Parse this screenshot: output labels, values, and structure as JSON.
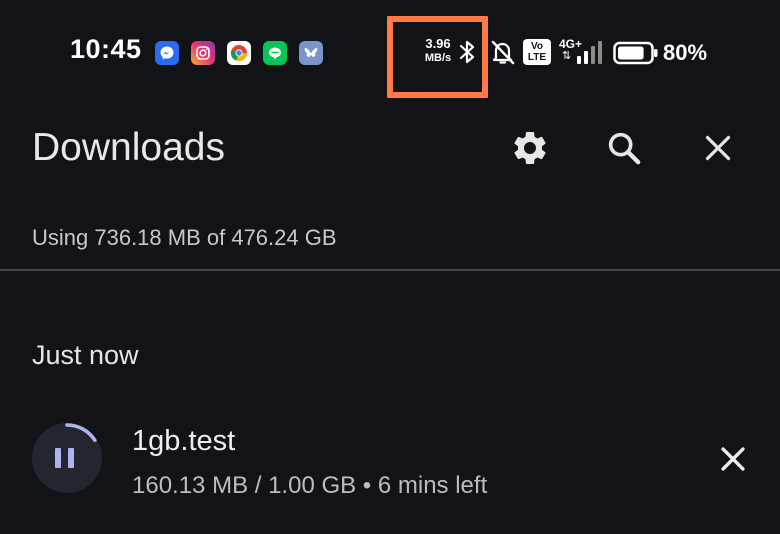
{
  "status_bar": {
    "time": "10:45",
    "app_icons": [
      "messenger-icon",
      "instagram-icon",
      "chrome-icon",
      "line-icon",
      "bluesky-icon"
    ],
    "net_speed_value": "3.96",
    "net_speed_unit": "MB/s",
    "volte_top": "Vo",
    "volte_bottom": "LTE",
    "network_type": "4G+",
    "network_arrows": "⇅",
    "battery_percent": "80%",
    "battery_level": 0.8,
    "highlight_color": "#ff7a45"
  },
  "header": {
    "title": "Downloads",
    "icons": [
      "gear-icon",
      "search-icon",
      "close-icon"
    ]
  },
  "storage": {
    "text": "Using 736.18 MB of 476.24 GB"
  },
  "section": {
    "label": "Just now"
  },
  "download": {
    "file_name": "1gb.test",
    "progress_text": "160.13 MB / 1.00 GB • 6 mins left",
    "progress_fraction": 0.16,
    "accent": "#aab4f0"
  }
}
